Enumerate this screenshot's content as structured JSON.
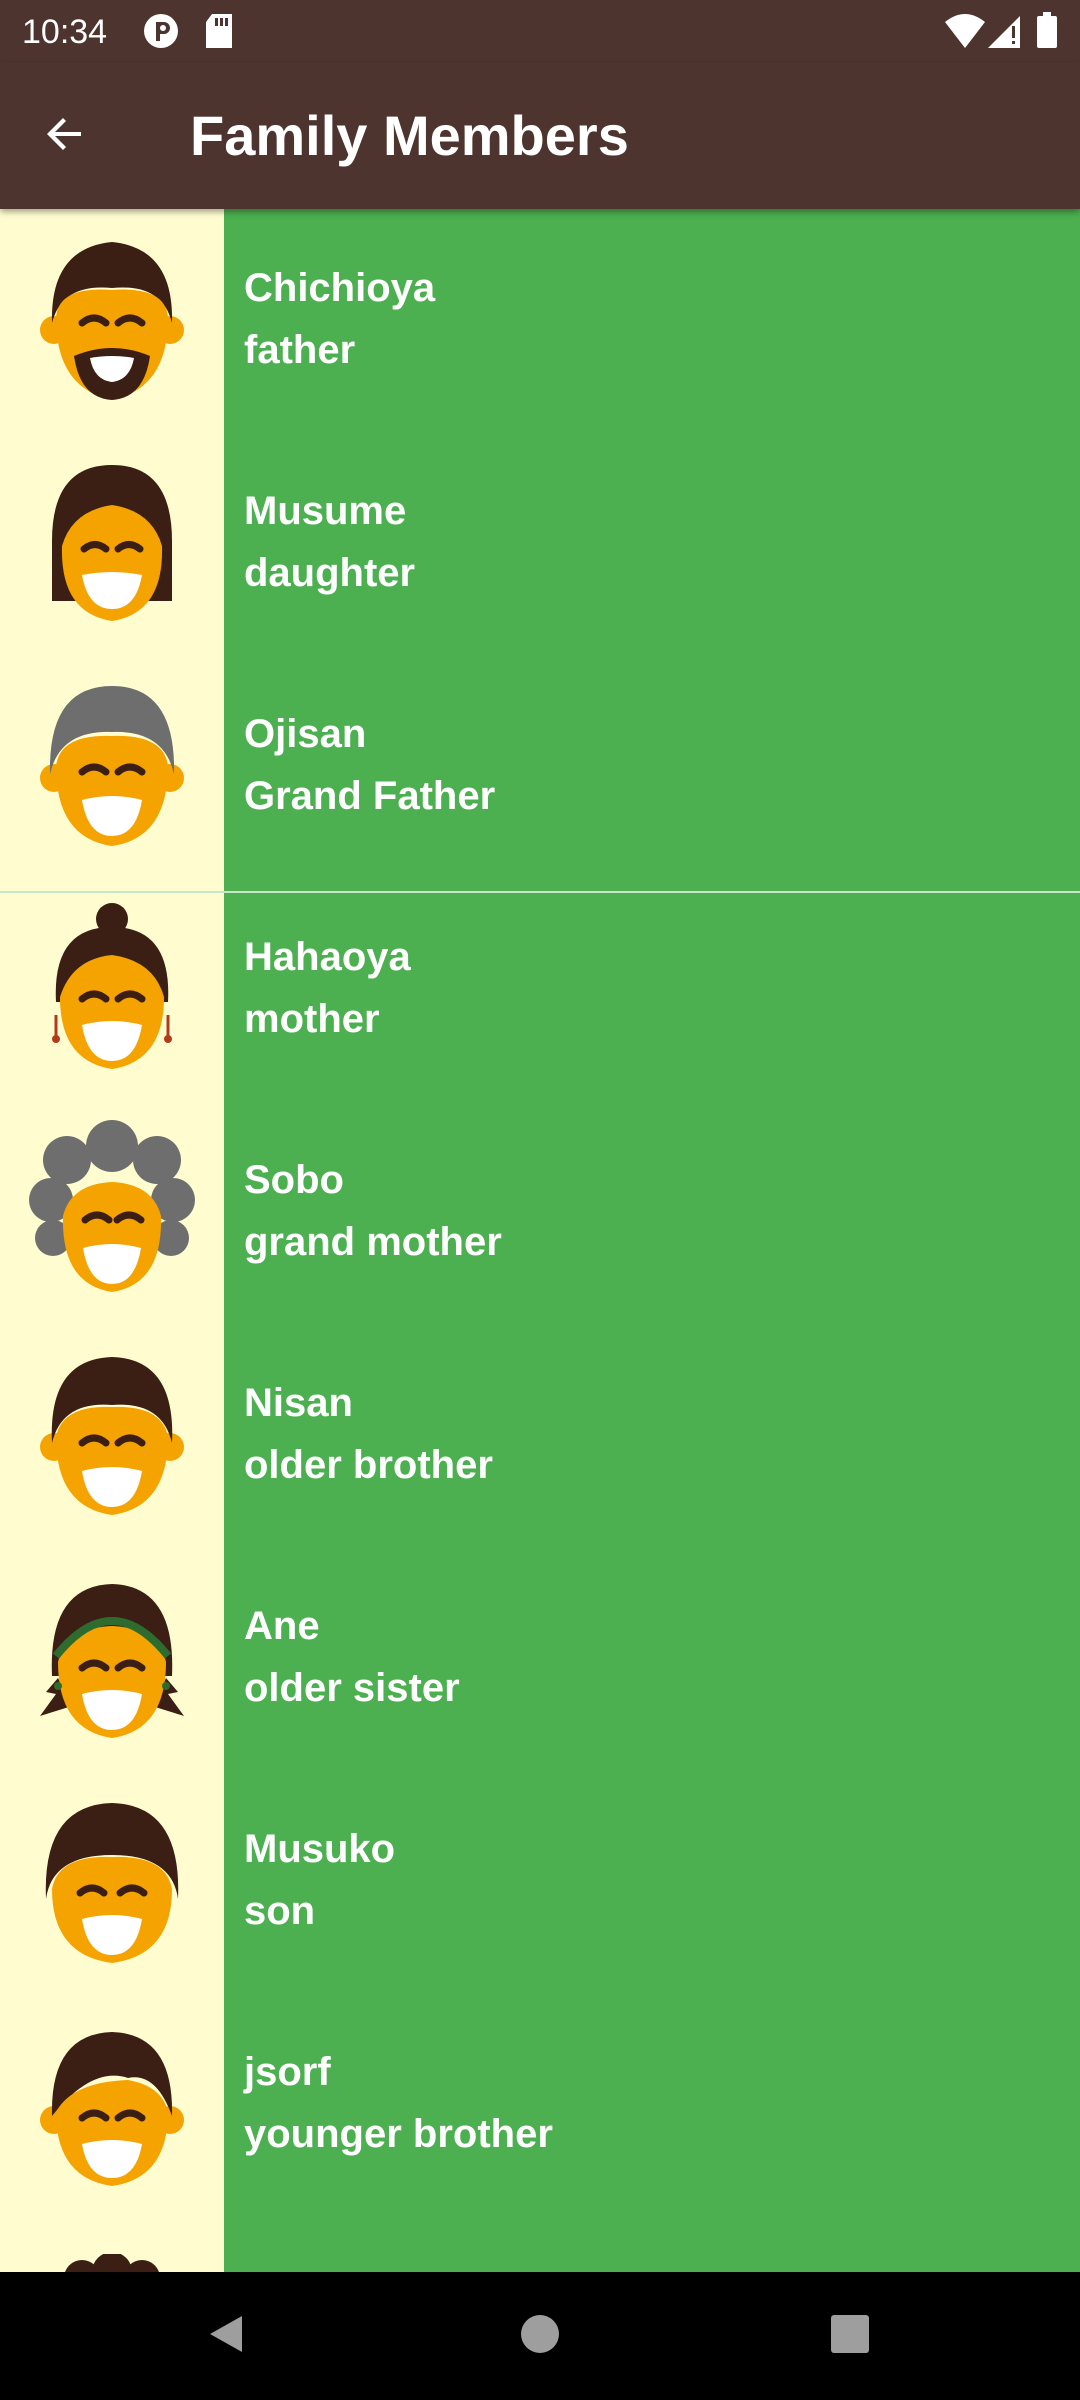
{
  "status_bar": {
    "time": "10:34",
    "icons": [
      "notification-p-icon",
      "sd-card-icon",
      "wifi-icon",
      "cell-signal-icon",
      "battery-icon"
    ]
  },
  "app_bar": {
    "title": "Family Members",
    "back_icon": "arrow-back-icon"
  },
  "colors": {
    "bar": "#4E342E",
    "item_bg": "#4CAF50",
    "avatar_bg": "#FFFDD0",
    "skin": "#F5A300",
    "text": "#ffffff"
  },
  "members": [
    {
      "miwok": "Chichioya",
      "translation": "father",
      "avatar": "father-avatar-icon"
    },
    {
      "miwok": "Musume",
      "translation": "daughter",
      "avatar": "daughter-avatar-icon"
    },
    {
      "miwok": "Ojisan",
      "translation": "Grand Father",
      "avatar": "grandfather-avatar-icon"
    },
    {
      "miwok": "Hahaoya",
      "translation": "mother",
      "avatar": "mother-avatar-icon"
    },
    {
      "miwok": "Sobo",
      "translation": "grand mother",
      "avatar": "grandmother-avatar-icon"
    },
    {
      "miwok": "Nisan",
      "translation": "older brother",
      "avatar": "older-brother-avatar-icon"
    },
    {
      "miwok": "Ane",
      "translation": "older sister",
      "avatar": "older-sister-avatar-icon"
    },
    {
      "miwok": "Musuko",
      "translation": "son",
      "avatar": "son-avatar-icon"
    },
    {
      "miwok": "jsorf",
      "translation": "younger brother",
      "avatar": "younger-brother-avatar-icon"
    }
  ],
  "nav_bar": {
    "icons": [
      "back-triangle-icon",
      "home-circle-icon",
      "recents-square-icon"
    ]
  }
}
